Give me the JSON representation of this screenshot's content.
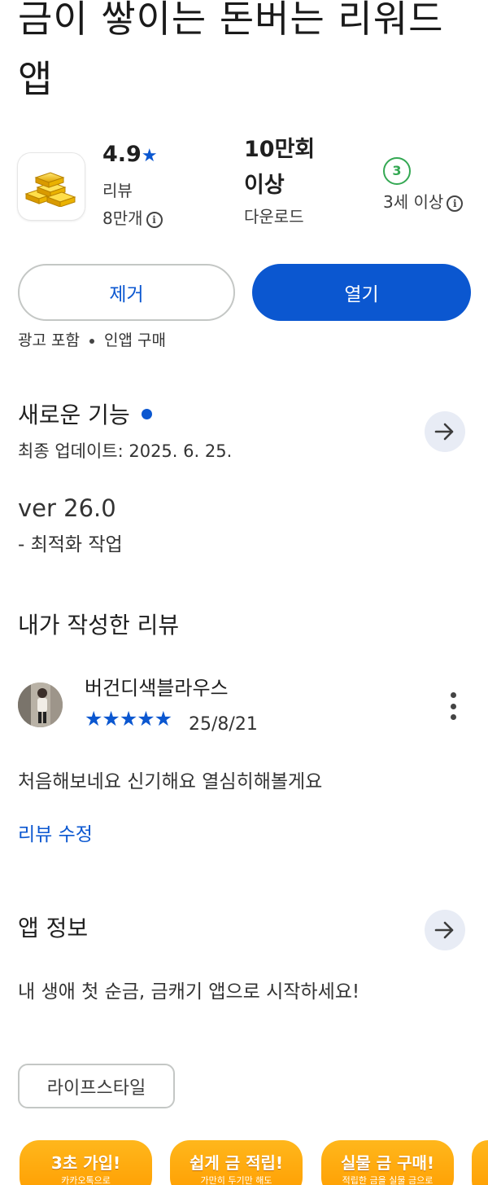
{
  "app": {
    "title": "금이 쌓이는 돈버는 리워드 앱"
  },
  "stats": {
    "rating_value": "4.9",
    "rating_star": "★",
    "reviews_label": "리뷰",
    "reviews_count": "8만개",
    "downloads_value": "10만회",
    "downloads_suffix": "이상",
    "downloads_label": "다운로드",
    "age_badge": "3",
    "age_label": "3세 이상"
  },
  "buttons": {
    "remove": "제거",
    "open": "열기"
  },
  "meta": {
    "ads": "광고 포함",
    "iap": "인앱 구매"
  },
  "whats_new": {
    "title": "새로운 기능",
    "updated": "최종 업데이트: 2025. 6. 25.",
    "version": "ver 26.0",
    "notes": "- 최적화 작업"
  },
  "my_review": {
    "section_title": "내가 작성한 리뷰",
    "author": "버건디색블라우스",
    "stars": "★★★★★",
    "rating": 5,
    "date": "25/8/21",
    "text": "처음해보네요 신기해요 열심히해볼게요",
    "edit_link": "리뷰 수정"
  },
  "about": {
    "title": "앱 정보",
    "description": "내 생애 첫 순금, 금캐기 앱으로 시작하세요!",
    "category": "라이프스타일"
  },
  "screenshots": [
    {
      "headline": "3초 가입!",
      "sub": "카카오톡으로"
    },
    {
      "headline": "쉽게 금 적립!",
      "sub": "가만히 두기만 해도"
    },
    {
      "headline": "실물 금 구매!",
      "sub": "적립한 금을 실물 금으로"
    }
  ],
  "colors": {
    "accent": "#0b57d0",
    "age_green": "#34a853",
    "screenshot_orange": "#ffa90d"
  }
}
